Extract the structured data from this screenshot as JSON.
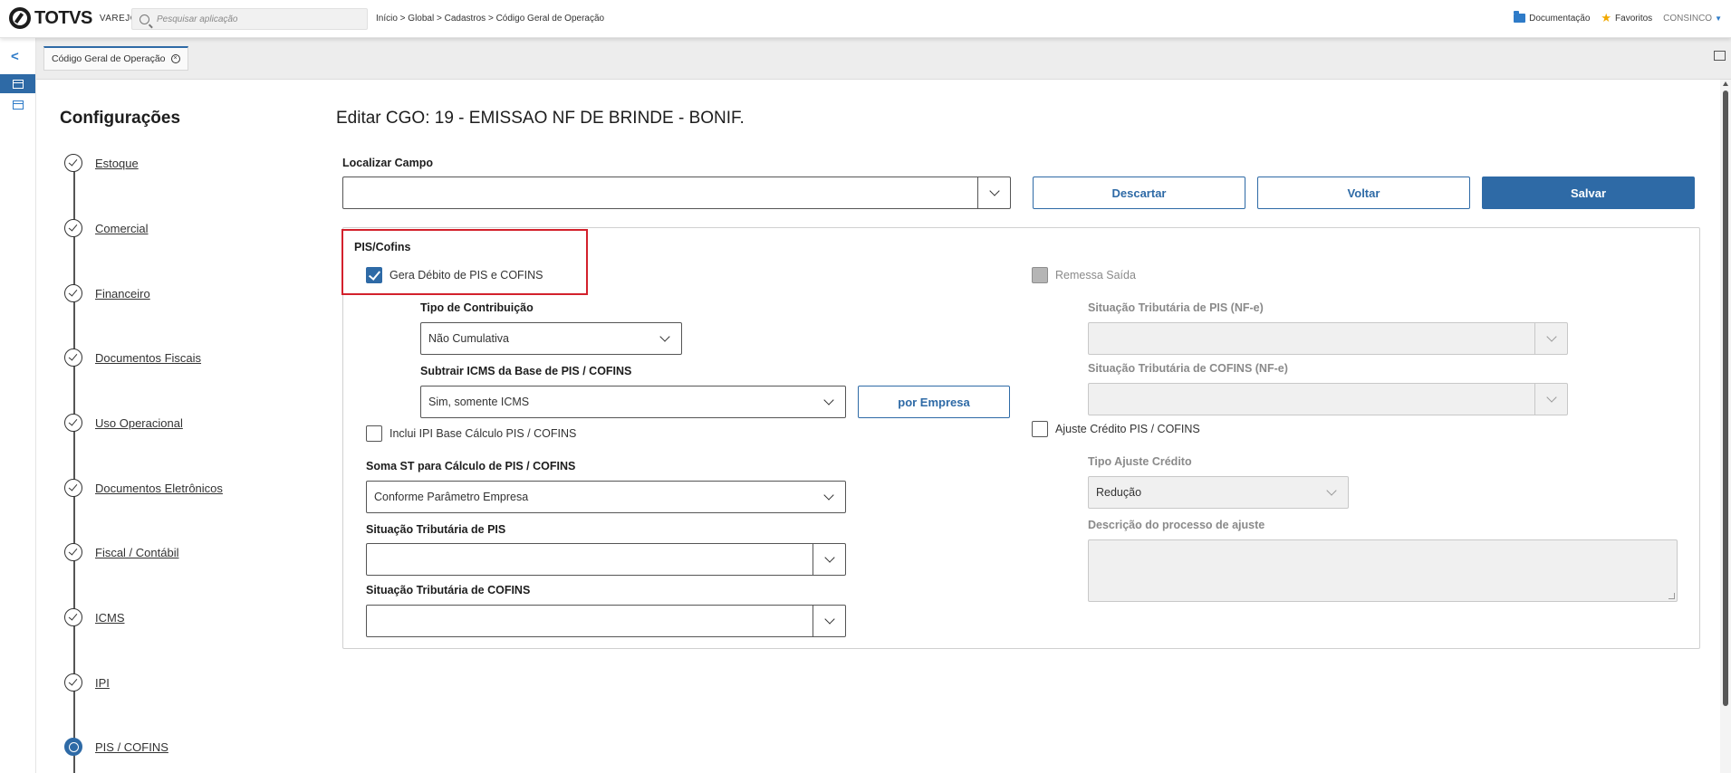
{
  "header": {
    "brand": "TOTVS",
    "brand_sub": "VAREJO",
    "search_placeholder": "Pesquisar aplicação",
    "breadcrumb": "Início > Global > Cadastros > Código Geral de Operação",
    "documentation": "Documentação",
    "favorites": "Favoritos",
    "user": "CONSINCO"
  },
  "tabs": [
    {
      "label": "Código Geral de Operação"
    }
  ],
  "sidebar": {
    "title": "Configurações",
    "steps": [
      {
        "label": "Estoque"
      },
      {
        "label": "Comercial"
      },
      {
        "label": "Financeiro"
      },
      {
        "label": "Documentos Fiscais"
      },
      {
        "label": "Uso Operacional"
      },
      {
        "label": "Documentos Eletrônicos"
      },
      {
        "label": "Fiscal / Contábil"
      },
      {
        "label": "ICMS"
      },
      {
        "label": "IPI"
      },
      {
        "label": "PIS / COFINS"
      }
    ]
  },
  "main": {
    "title": "Editar CGO: 19 - EMISSAO NF DE BRINDE - BONIF.",
    "find_field_label": "Localizar Campo",
    "find_field_value": "",
    "discard": "Descartar",
    "back": "Voltar",
    "save": "Salvar"
  },
  "pis_cofins": {
    "section_title": "PIS/Cofins",
    "gera_debito": "Gera Débito de PIS e COFINS",
    "tipo_contribuicao_label": "Tipo de Contribuição",
    "tipo_contribuicao_value": "Não Cumulativa",
    "subtrair_icms_label": "Subtrair ICMS da Base de PIS / COFINS",
    "subtrair_icms_value": "Sim, somente ICMS",
    "por_empresa": "por Empresa",
    "inclui_ipi": "Inclui IPI Base Cálculo PIS / COFINS",
    "soma_st_label": "Soma ST para Cálculo de PIS / COFINS",
    "soma_st_value": "Conforme Parâmetro Empresa",
    "sit_pis_label": "Situação Tributária de PIS",
    "sit_pis_value": "",
    "sit_cofins_label": "Situação Tributária de COFINS",
    "sit_cofins_value": "",
    "remessa_saida": "Remessa Saída",
    "sit_pis_nfe_label": "Situação Tributária de PIS (NF-e)",
    "sit_pis_nfe_value": "",
    "sit_cofins_nfe_label": "Situação Tributária de COFINS (NF-e)",
    "sit_cofins_nfe_value": "",
    "ajuste_credito": "Ajuste Crédito PIS / COFINS",
    "tipo_ajuste_label": "Tipo Ajuste Crédito",
    "tipo_ajuste_value": "Redução",
    "descricao_label": "Descrição do processo de ajuste",
    "descricao_value": ""
  }
}
